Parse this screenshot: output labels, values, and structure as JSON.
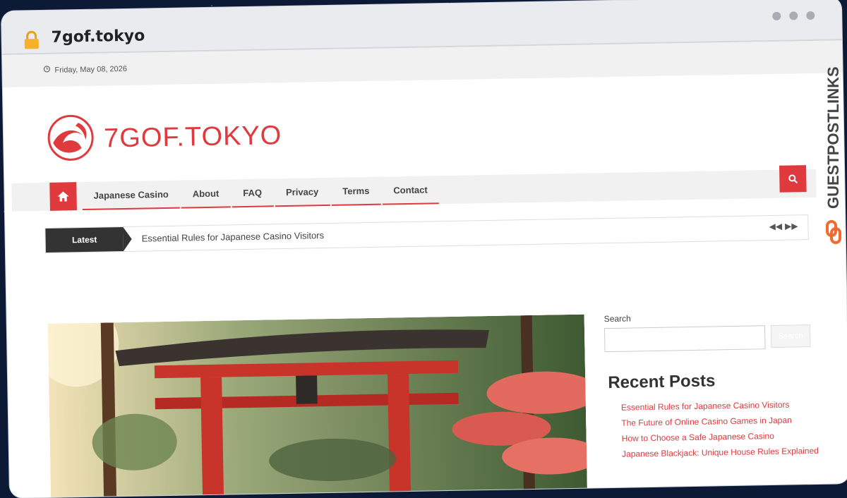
{
  "browser": {
    "domain": "7gof.tokyo"
  },
  "topbar": {
    "date": "Friday, May 08, 2026"
  },
  "site": {
    "logo_text": "7GOF.TOKYO",
    "accent": "#e0393e"
  },
  "nav": {
    "items": [
      {
        "label": "Japanese Casino"
      },
      {
        "label": "About"
      },
      {
        "label": "FAQ"
      },
      {
        "label": "Privacy"
      },
      {
        "label": "Terms"
      },
      {
        "label": "Contact"
      }
    ]
  },
  "ticker": {
    "label": "Latest",
    "headline": "Essential Rules for Japanese Casino Visitors"
  },
  "sidebar": {
    "search_label": "Search",
    "search_button": "Search",
    "recent_title": "Recent Posts",
    "recent_posts": [
      "Essential Rules for Japanese Casino Visitors",
      "The Future of Online Casino Games in Japan",
      "How to Choose a Safe Japanese Casino",
      "Japanese Blackjack: Unique House Rules Explained"
    ]
  },
  "watermark": {
    "text": "GUESTPOSTLINKS"
  }
}
